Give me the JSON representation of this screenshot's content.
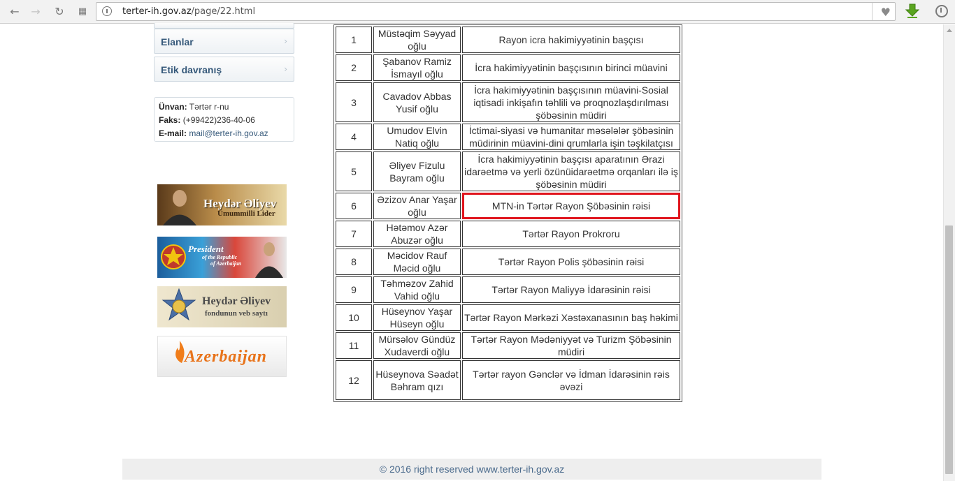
{
  "browser": {
    "url_host": "terter-ih.gov.az",
    "url_path": "/page/22.html"
  },
  "sidebar": {
    "items": [
      {
        "label": "Elanlar"
      },
      {
        "label": "Etik davranış"
      }
    ],
    "contact": {
      "address_label": "Ünvan:",
      "address_value": "Tərtər r-nu",
      "fax_label": "Faks:",
      "fax_value": "(+99422)236-40-06",
      "email_label": "E-mail:",
      "email_value": "mail@terter-ih.gov.az"
    },
    "banners": [
      {
        "line1": "Heydər Əliyev",
        "line2": "Ümummilli Lider"
      },
      {
        "line1": "President",
        "line2": "of the Republic",
        "line3": "of Azerbaijan"
      },
      {
        "line1": "Heydər Əliyev",
        "line2": "fondunun veb saytı"
      },
      {
        "line1": "Azerbaijan"
      }
    ]
  },
  "table": {
    "rows": [
      {
        "n": "1",
        "name": "Müstəqim Səyyad oğlu",
        "position": "Rayon icra hakimiyyətinin başçısı"
      },
      {
        "n": "2",
        "name": "Şabanov Ramiz İsmayıl oğlu",
        "position": "İcra hakimiyyətinin başçısının birinci müavini"
      },
      {
        "n": "3",
        "name": "Cavadov Abbas Yusif oğlu",
        "position": "İcra hakimiyyətinin başçısının müavini-Sosial iqtisadi inkişafın təhlili və proqnozlaşdırılması şöbəsinin müdiri"
      },
      {
        "n": "4",
        "name": "Umudov Elvin Natiq oğlu",
        "position": "İctimai-siyasi və humanitar məsələlər şöbəsinin müdirinin müavini-dini qrumlarla işin təşkilatçısı"
      },
      {
        "n": "5",
        "name": "Əliyev Fizulu Bayram oğlu",
        "position": "İcra hakimiyyətinin başçısı aparatının Ərazi idarəetmə və yerli özünüidarəetmə orqanları ilə iş şöbəsinin müdiri"
      },
      {
        "n": "6",
        "name": "Əzizov Anar Yaşar oğlu",
        "position": "MTN-in Tərtər Rayon Şöbəsinin rəisi"
      },
      {
        "n": "7",
        "name": "Hətəmov Azər Abuzər oğlu",
        "position": "Tərtər Rayon Prokroru"
      },
      {
        "n": "8",
        "name": "Məcidov Rauf Məcid oğlu",
        "position": "Tərtər Rayon Polis şöbəsinin rəisi"
      },
      {
        "n": "9",
        "name": "Təhməzov Zahid Vahid oğlu",
        "position": "Tərtər Rayon Maliyyə İdarəsinin rəisi"
      },
      {
        "n": "10",
        "name": "Hüseynov Yaşar Hüseyn oğlu",
        "position": "Tərtər Rayon Mərkəzi Xəstəxanasının baş həkimi"
      },
      {
        "n": "11",
        "name": "Mürsəlov Gündüz Xudaverdi oğlu",
        "position": "Tərtər Rayon Mədəniyyət və Turizm Şöbəsinin müdiri"
      },
      {
        "n": "12",
        "name": "Hüseynova Səadət Bəhram qızı",
        "position": "Tərtər rayon Gənclər və İdman İdarəsinin rəis əvəzi"
      }
    ],
    "highlighted_row": 6,
    "highlight_color": "#e0151d"
  },
  "footer": {
    "text": "© 2016 right reserved www.terter-ih.gov.az"
  }
}
